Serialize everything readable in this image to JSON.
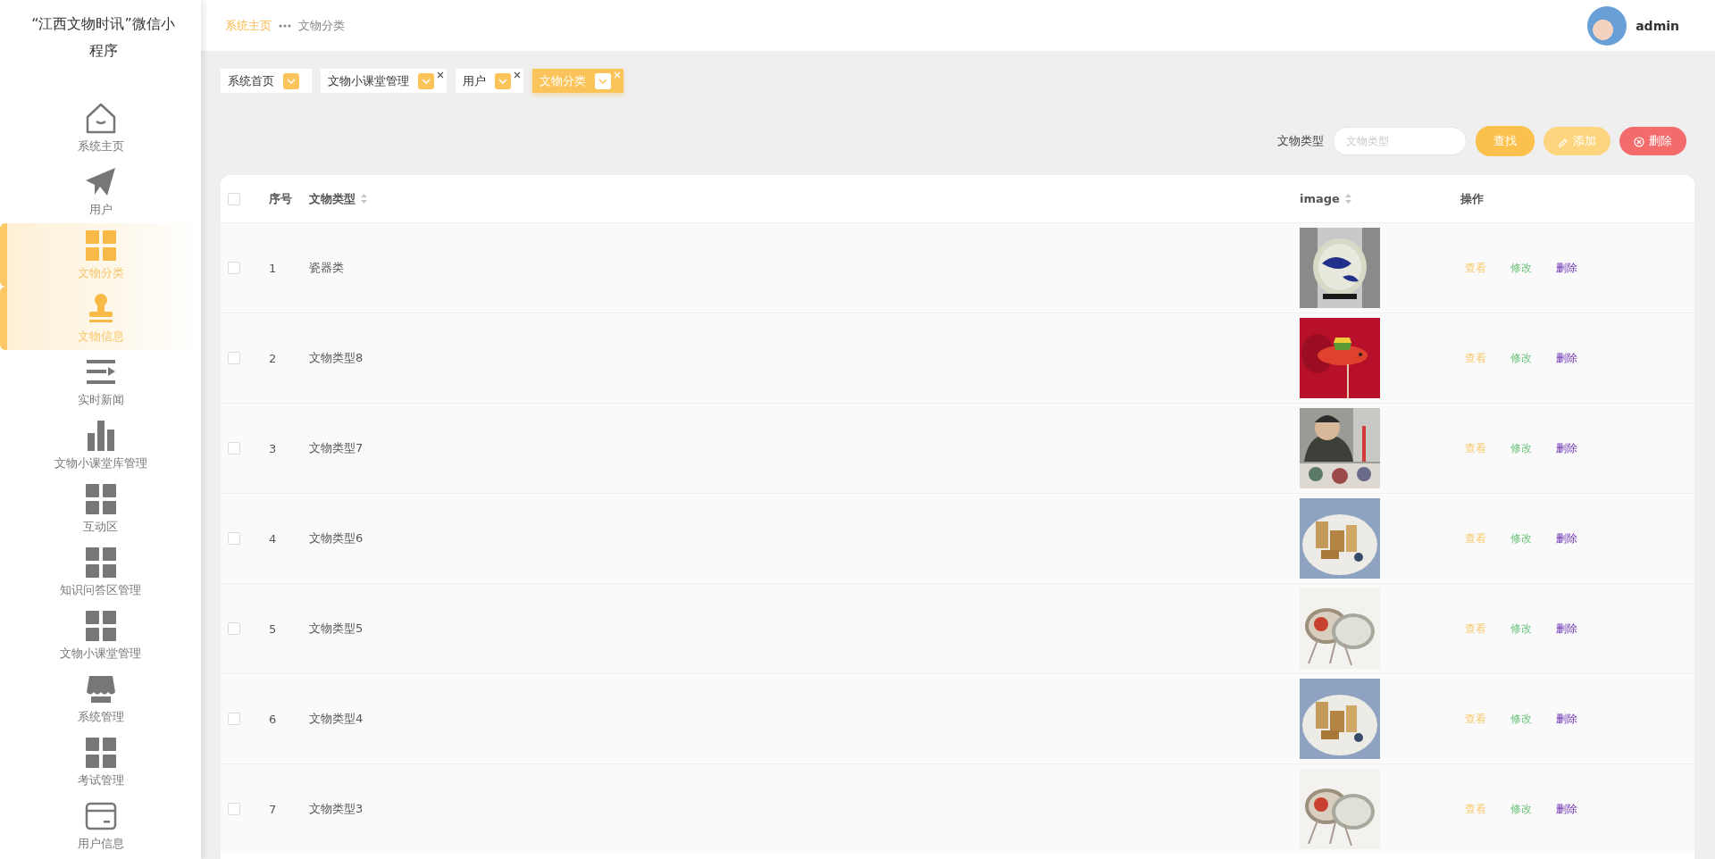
{
  "sidebar": {
    "title": "“江西文物时讯”微信小程序",
    "items": [
      {
        "label": "系统主页",
        "selected": false
      },
      {
        "label": "用户",
        "selected": false
      },
      {
        "label": "文物分类",
        "selected": true
      },
      {
        "label": "文物信息",
        "selected": true
      },
      {
        "label": "实时新闻",
        "selected": false
      },
      {
        "label": "文物小课堂库管理",
        "selected": false
      },
      {
        "label": "互动区",
        "selected": false
      },
      {
        "label": "知识问答区管理",
        "selected": false
      },
      {
        "label": "文物小课堂管理",
        "selected": false
      },
      {
        "label": "系统管理",
        "selected": false
      },
      {
        "label": "考试管理",
        "selected": false
      },
      {
        "label": "用户信息",
        "selected": false
      }
    ]
  },
  "header": {
    "breadcrumb": [
      {
        "label": "系统主页"
      },
      {
        "label": "文物分类"
      }
    ],
    "user": "admin"
  },
  "tabs": [
    {
      "label": "系统首页",
      "selected": false,
      "closable": false
    },
    {
      "label": "文物小课堂管理",
      "selected": false,
      "closable": true
    },
    {
      "label": "用户",
      "selected": false,
      "closable": true
    },
    {
      "label": "文物分类",
      "selected": true,
      "closable": true
    }
  ],
  "search": {
    "label": "文物类型",
    "placeholder": "文物类型",
    "buttons": [
      {
        "label": "查找",
        "kind": "search"
      },
      {
        "label": "添加",
        "kind": "add"
      },
      {
        "label": "删除",
        "kind": "delete"
      }
    ]
  },
  "table": {
    "header_checked": false,
    "columns": [
      {
        "label": "序号",
        "sortable": false
      },
      {
        "label": "文物类型",
        "sortable": true
      },
      {
        "label": "image",
        "sortable": true
      },
      {
        "label": "操作",
        "sortable": false
      }
    ],
    "rows": [
      {
        "checked": false,
        "index": "1",
        "type": "瓷器类",
        "image": {
          "kind": "picture"
        },
        "actions": [
          "查看",
          "修改",
          "删除"
        ]
      },
      {
        "checked": false,
        "index": "2",
        "type": "文物类型8",
        "image": {
          "kind": "picture"
        },
        "actions": [
          "查看",
          "修改",
          "删除"
        ]
      },
      {
        "checked": false,
        "index": "3",
        "type": "文物类型7",
        "image": {
          "kind": "picture"
        },
        "actions": [
          "查看",
          "修改",
          "删除"
        ]
      },
      {
        "checked": false,
        "index": "4",
        "type": "文物类型6",
        "image": {
          "kind": "picture"
        },
        "actions": [
          "查看",
          "修改",
          "删除"
        ]
      },
      {
        "checked": false,
        "index": "5",
        "type": "文物类型5",
        "image": {
          "kind": "picture"
        },
        "actions": [
          "查看",
          "修改",
          "删除"
        ]
      },
      {
        "checked": false,
        "index": "6",
        "type": "文物类型4",
        "image": {
          "kind": "picture"
        },
        "actions": [
          "查看",
          "修改",
          "删除"
        ]
      },
      {
        "checked": false,
        "index": "7",
        "type": "文物类型3",
        "image": {
          "kind": "picture"
        },
        "actions": [
          "查看",
          "修改",
          "删除"
        ]
      }
    ]
  }
}
